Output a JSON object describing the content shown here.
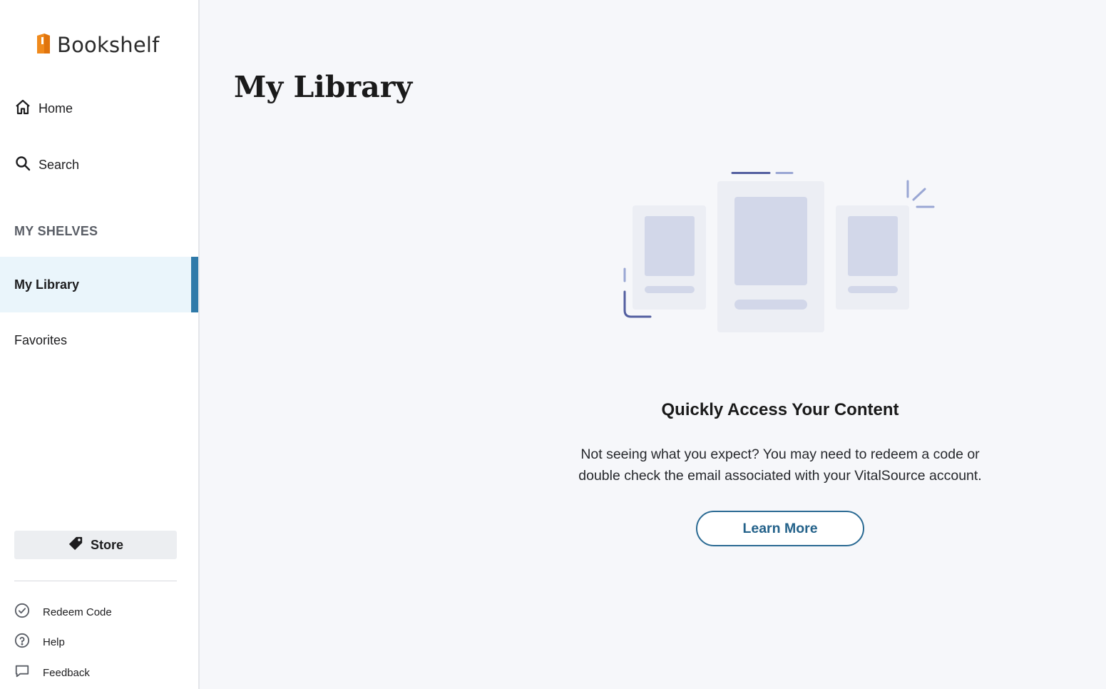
{
  "app": {
    "name": "Bookshelf"
  },
  "nav": {
    "home": "Home",
    "search": "Search"
  },
  "shelves": {
    "heading": "MY SHELVES",
    "items": [
      {
        "label": "My Library",
        "active": true
      },
      {
        "label": "Favorites",
        "active": false
      }
    ]
  },
  "sidebar_footer": {
    "store": "Store",
    "redeem": "Redeem Code",
    "help": "Help",
    "feedback": "Feedback"
  },
  "main": {
    "title": "My Library",
    "empty_state": {
      "heading": "Quickly Access Your Content",
      "body_line1": "Not seeing what you expect? You may need to redeem a code or",
      "body_line2": "double check the email associated with your VitalSource account.",
      "button": "Learn More"
    }
  },
  "icons": {
    "logo": "bookshelf-logo-icon",
    "home": "home-icon",
    "search": "search-icon",
    "store": "tag-icon",
    "redeem": "check-circle-icon",
    "help": "help-circle-icon",
    "feedback": "chat-bubble-icon"
  },
  "colors": {
    "accent": "#2f7aa9",
    "active_bg": "#eaf5fb",
    "logo_orange": "#f08a1c",
    "page_bg": "#f6f7fa"
  }
}
